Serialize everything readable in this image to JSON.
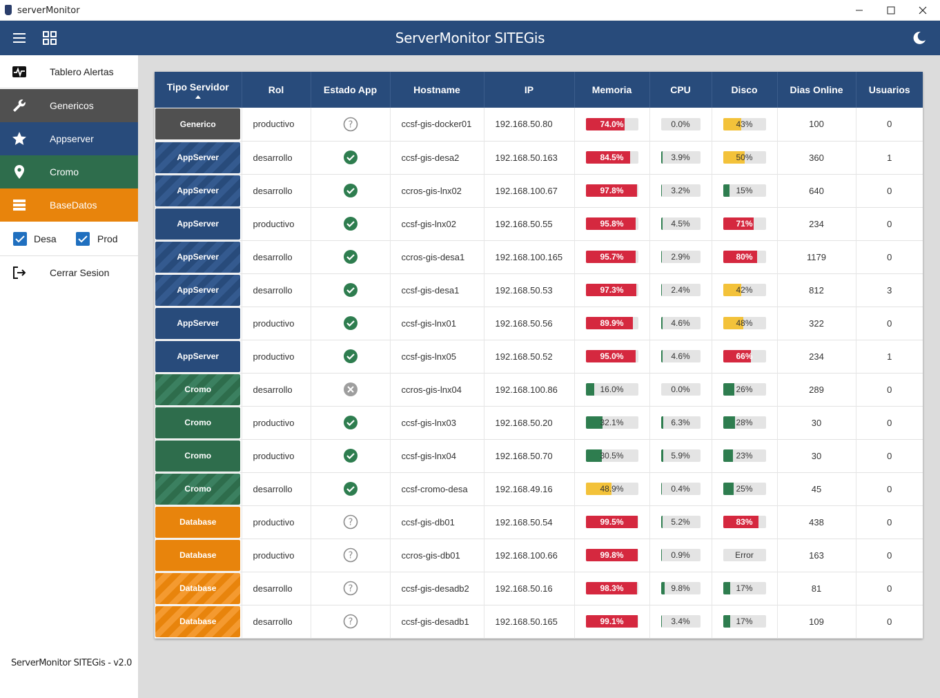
{
  "window": {
    "title": "serverMonitor",
    "minimize": "—",
    "maximize": "☐",
    "close": "✕"
  },
  "header": {
    "title": "ServerMonitor SITEGis"
  },
  "sidebar": {
    "items": [
      {
        "label": "Tablero Alertas"
      },
      {
        "label": "Genericos"
      },
      {
        "label": "Appserver"
      },
      {
        "label": "Cromo"
      },
      {
        "label": "BaseDatos"
      }
    ],
    "filters": {
      "desa_label": "Desa",
      "prod_label": "Prod",
      "desa_checked": true,
      "prod_checked": true
    },
    "logout_label": "Cerrar Sesion",
    "version": "ServerMonitor SITEGis - v2.0"
  },
  "colors": {
    "primary": "#284b7b",
    "generico": "#505050",
    "cromo": "#2e6d4c",
    "database": "#e8840c",
    "red": "#d5283f",
    "yellow": "#f3c23a",
    "green": "#2e7d4f",
    "ok": "#2e7d4f"
  },
  "table": {
    "columns": [
      "Tipo Servidor",
      "Rol",
      "Estado App",
      "Hostname",
      "IP",
      "Memoria",
      "CPU",
      "Disco",
      "Dias Online",
      "Usuarios"
    ],
    "sorted_by": "Tipo Servidor",
    "rows": [
      {
        "tipo": "Generico",
        "chip": "generico",
        "striped": false,
        "rol": "productivo",
        "estado": "unknown",
        "host": "ccsf-gis-docker01",
        "ip": "192.168.50.80",
        "mem": 74.0,
        "mem_text": "74.0%",
        "cpu": 0.0,
        "cpu_text": "0.0%",
        "disk": 43,
        "disk_text": "43%",
        "dias": "100",
        "usuarios": "0"
      },
      {
        "tipo": "AppServer",
        "chip": "appserver",
        "striped": true,
        "rol": "desarrollo",
        "estado": "ok",
        "host": "ccsf-gis-desa2",
        "ip": "192.168.50.163",
        "mem": 84.5,
        "mem_text": "84.5%",
        "cpu": 3.9,
        "cpu_text": "3.9%",
        "disk": 50,
        "disk_text": "50%",
        "dias": "360",
        "usuarios": "1"
      },
      {
        "tipo": "AppServer",
        "chip": "appserver",
        "striped": true,
        "rol": "desarrollo",
        "estado": "ok",
        "host": "ccros-gis-lnx02",
        "ip": "192.168.100.67",
        "mem": 97.8,
        "mem_text": "97.8%",
        "cpu": 3.2,
        "cpu_text": "3.2%",
        "disk": 15,
        "disk_text": "15%",
        "dias": "640",
        "usuarios": "0"
      },
      {
        "tipo": "AppServer",
        "chip": "appserver",
        "striped": false,
        "rol": "productivo",
        "estado": "ok",
        "host": "ccsf-gis-lnx02",
        "ip": "192.168.50.55",
        "mem": 95.8,
        "mem_text": "95.8%",
        "cpu": 4.5,
        "cpu_text": "4.5%",
        "disk": 71,
        "disk_text": "71%",
        "dias": "234",
        "usuarios": "0"
      },
      {
        "tipo": "AppServer",
        "chip": "appserver",
        "striped": true,
        "rol": "desarrollo",
        "estado": "ok",
        "host": "ccros-gis-desa1",
        "ip": "192.168.100.165",
        "mem": 95.7,
        "mem_text": "95.7%",
        "cpu": 2.9,
        "cpu_text": "2.9%",
        "disk": 80,
        "disk_text": "80%",
        "dias": "1179",
        "usuarios": "0"
      },
      {
        "tipo": "AppServer",
        "chip": "appserver",
        "striped": true,
        "rol": "desarrollo",
        "estado": "ok",
        "host": "ccsf-gis-desa1",
        "ip": "192.168.50.53",
        "mem": 97.3,
        "mem_text": "97.3%",
        "cpu": 2.4,
        "cpu_text": "2.4%",
        "disk": 42,
        "disk_text": "42%",
        "dias": "812",
        "usuarios": "3"
      },
      {
        "tipo": "AppServer",
        "chip": "appserver",
        "striped": false,
        "rol": "productivo",
        "estado": "ok",
        "host": "ccsf-gis-lnx01",
        "ip": "192.168.50.56",
        "mem": 89.9,
        "mem_text": "89.9%",
        "cpu": 4.6,
        "cpu_text": "4.6%",
        "disk": 48,
        "disk_text": "48%",
        "dias": "322",
        "usuarios": "0"
      },
      {
        "tipo": "AppServer",
        "chip": "appserver",
        "striped": false,
        "rol": "productivo",
        "estado": "ok",
        "host": "ccsf-gis-lnx05",
        "ip": "192.168.50.52",
        "mem": 95.0,
        "mem_text": "95.0%",
        "cpu": 4.6,
        "cpu_text": "4.6%",
        "disk": 66,
        "disk_text": "66%",
        "dias": "234",
        "usuarios": "1"
      },
      {
        "tipo": "Cromo",
        "chip": "cromo",
        "striped": true,
        "rol": "desarrollo",
        "estado": "error",
        "host": "ccros-gis-lnx04",
        "ip": "192.168.100.86",
        "mem": 16.0,
        "mem_text": "16.0%",
        "cpu": 0.0,
        "cpu_text": "0.0%",
        "disk": 26,
        "disk_text": "26%",
        "dias": "289",
        "usuarios": "0"
      },
      {
        "tipo": "Cromo",
        "chip": "cromo",
        "striped": false,
        "rol": "productivo",
        "estado": "ok",
        "host": "ccsf-gis-lnx03",
        "ip": "192.168.50.20",
        "mem": 32.1,
        "mem_text": "32.1%",
        "cpu": 6.3,
        "cpu_text": "6.3%",
        "disk": 28,
        "disk_text": "28%",
        "dias": "30",
        "usuarios": "0"
      },
      {
        "tipo": "Cromo",
        "chip": "cromo",
        "striped": false,
        "rol": "productivo",
        "estado": "ok",
        "host": "ccsf-gis-lnx04",
        "ip": "192.168.50.70",
        "mem": 30.5,
        "mem_text": "30.5%",
        "cpu": 5.9,
        "cpu_text": "5.9%",
        "disk": 23,
        "disk_text": "23%",
        "dias": "30",
        "usuarios": "0"
      },
      {
        "tipo": "Cromo",
        "chip": "cromo",
        "striped": true,
        "rol": "desarrollo",
        "estado": "ok",
        "host": "ccsf-cromo-desa",
        "ip": "192.168.49.16",
        "mem": 48.9,
        "mem_text": "48.9%",
        "cpu": 0.4,
        "cpu_text": "0.4%",
        "disk": 25,
        "disk_text": "25%",
        "dias": "45",
        "usuarios": "0"
      },
      {
        "tipo": "Database",
        "chip": "database",
        "striped": false,
        "rol": "productivo",
        "estado": "unknown",
        "host": "ccsf-gis-db01",
        "ip": "192.168.50.54",
        "mem": 99.5,
        "mem_text": "99.5%",
        "cpu": 5.2,
        "cpu_text": "5.2%",
        "disk": 83,
        "disk_text": "83%",
        "dias": "438",
        "usuarios": "0"
      },
      {
        "tipo": "Database",
        "chip": "database",
        "striped": false,
        "rol": "productivo",
        "estado": "unknown",
        "host": "ccros-gis-db01",
        "ip": "192.168.100.66",
        "mem": 99.8,
        "mem_text": "99.8%",
        "cpu": 0.9,
        "cpu_text": "0.9%",
        "disk": 0,
        "disk_text": "Error",
        "dias": "163",
        "usuarios": "0"
      },
      {
        "tipo": "Database",
        "chip": "database",
        "striped": true,
        "rol": "desarrollo",
        "estado": "unknown",
        "host": "ccsf-gis-desadb2",
        "ip": "192.168.50.16",
        "mem": 98.3,
        "mem_text": "98.3%",
        "cpu": 9.8,
        "cpu_text": "9.8%",
        "disk": 17,
        "disk_text": "17%",
        "dias": "81",
        "usuarios": "0"
      },
      {
        "tipo": "Database",
        "chip": "database",
        "striped": true,
        "rol": "desarrollo",
        "estado": "unknown",
        "host": "ccsf-gis-desadb1",
        "ip": "192.168.50.165",
        "mem": 99.1,
        "mem_text": "99.1%",
        "cpu": 3.4,
        "cpu_text": "3.4%",
        "disk": 17,
        "disk_text": "17%",
        "dias": "109",
        "usuarios": "0"
      }
    ]
  }
}
